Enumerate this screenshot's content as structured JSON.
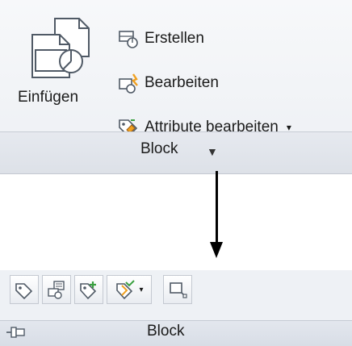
{
  "ribbon": {
    "insert_label": "Einfügen",
    "create_label": "Erstellen",
    "edit_label": "Bearbeiten",
    "edit_attributes_label": "Attribute bearbeiten",
    "panel_title": "Block"
  },
  "collapsed": {
    "panel_title": "Block"
  },
  "icons": {
    "insert": "block-insert-icon",
    "create": "block-create-icon",
    "edit": "block-edit-icon",
    "edit_attributes": "attribute-edit-icon",
    "dropdown": "chevron-down-icon",
    "pin": "pin-icon",
    "tools": [
      "define-attribute-icon",
      "attribute-display-icon",
      "edit-attribute-icon",
      "sync-attributes-icon",
      "block-panel-icon"
    ]
  },
  "colors": {
    "accent_orange": "#f0a020",
    "accent_green": "#3aa040",
    "outline": "#505a66"
  }
}
